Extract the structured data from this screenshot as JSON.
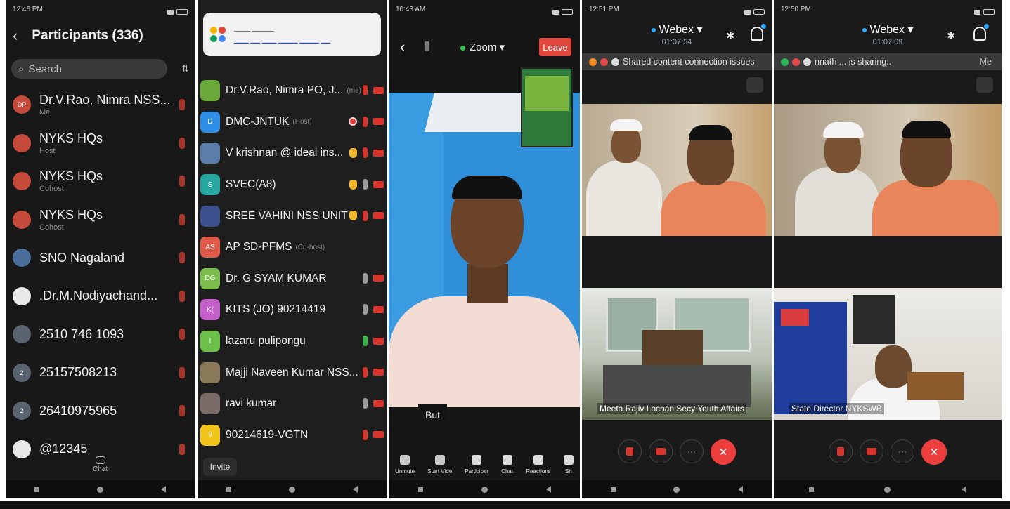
{
  "phone1": {
    "status_time": "12:46 PM",
    "title": "Participants (336)",
    "search_placeholder": "Search",
    "participants": [
      {
        "name": "Dr.V.Rao, Nimra NSS...",
        "role": "Me",
        "avatar": "DP"
      },
      {
        "name": "NYKS HQs",
        "role": "Host",
        "avatar": ""
      },
      {
        "name": "NYKS HQs",
        "role": "Cohost",
        "avatar": ""
      },
      {
        "name": "NYKS HQs",
        "role": "Cohost",
        "avatar": ""
      },
      {
        "name": "SNO Nagaland",
        "role": "",
        "avatar": ""
      },
      {
        "name": ".Dr.M.Nodiyachand...",
        "role": "",
        "avatar": ""
      },
      {
        "name": "2510 746 1093",
        "role": "",
        "avatar": ""
      },
      {
        "name": "25157508213",
        "role": "",
        "avatar": "2"
      },
      {
        "name": "26410975965",
        "role": "",
        "avatar": "2"
      },
      {
        "name": "@12345",
        "role": "",
        "avatar": ""
      }
    ],
    "chat_label": "Chat"
  },
  "phone2": {
    "participants": [
      {
        "name": "Dr.V.Rao, Nimra PO, J...",
        "role": "(me)",
        "avatar": "",
        "color": "#6aa83a"
      },
      {
        "name": "DMC-JNTUK",
        "role": "(Host)",
        "avatar": "D",
        "color": "#2f8fe6"
      },
      {
        "name": "V krishnan @ ideal ins...",
        "role": "",
        "avatar": "",
        "color": "#5a7ea8"
      },
      {
        "name": "SVEC(A8)",
        "role": "",
        "avatar": "S",
        "color": "#27a7a0"
      },
      {
        "name": "SREE VAHINI NSS UNIT",
        "role": "",
        "avatar": "",
        "color": "#3b4f8c"
      },
      {
        "name": "AP SD-PFMS",
        "role": "(Co-host)",
        "avatar": "AS",
        "color": "#e05a49"
      },
      {
        "name": "Dr. G SYAM KUMAR",
        "role": "",
        "avatar": "DG",
        "color": "#7bbd4a"
      },
      {
        "name": "KITS (JO) 90214419",
        "role": "",
        "avatar": "K(",
        "color": "#c45fc9"
      },
      {
        "name": "lazaru pulipongu",
        "role": "",
        "avatar": "l",
        "color": "#6cc04a"
      },
      {
        "name": "Majji Naveen Kumar NSS...",
        "role": "",
        "avatar": "",
        "color": "#8a7a5a"
      },
      {
        "name": "ravi kumar",
        "role": "",
        "avatar": "",
        "color": "#7a6a68"
      },
      {
        "name": "90214619-VGTN",
        "role": "",
        "avatar": "9",
        "color": "#f2c318"
      }
    ],
    "invite_label": "Invite"
  },
  "phone3": {
    "status_time": "10:43 AM",
    "app_label": "Zoom",
    "leave_label": "Leave",
    "caption": "But",
    "toolbar": [
      {
        "label": "Unmute",
        "icon": "mic-icon"
      },
      {
        "label": "Start Vide",
        "icon": "video-off-icon"
      },
      {
        "label": "Participar",
        "icon": "participants-icon"
      },
      {
        "label": "Chat",
        "icon": "chat-icon"
      },
      {
        "label": "Reactions",
        "icon": "reactions-icon"
      },
      {
        "label": "Sh",
        "icon": "share-icon"
      }
    ]
  },
  "phone4": {
    "status_time": "12:51 PM",
    "app_label": "Webex",
    "timer": "01:07:54",
    "banner": "Shared content connection issues",
    "video2_label": "Meeta Rajiv Lochan Secy Youth Affairs"
  },
  "phone5": {
    "status_time": "12:50 PM",
    "app_label": "Webex",
    "timer": "01:07:09",
    "banner": "nnath ... is sharing..",
    "banner_right": "Me",
    "video2_label": "State Director NYKSWB"
  }
}
